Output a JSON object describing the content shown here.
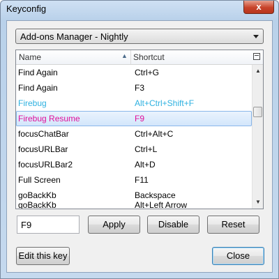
{
  "window": {
    "title": "Keyconfig",
    "close_glyph": "x"
  },
  "dropdown": {
    "selected": "Add-ons Manager - Nightly"
  },
  "list": {
    "columns": {
      "name": "Name",
      "shortcut": "Shortcut"
    },
    "rows": [
      {
        "name": "Find Again",
        "shortcut": "Ctrl+G",
        "color": "#000000"
      },
      {
        "name": "Find Again",
        "shortcut": "F3",
        "color": "#000000"
      },
      {
        "name": "Firebug",
        "shortcut": "Alt+Ctrl+Shift+F",
        "color": "#2eb1e0"
      },
      {
        "name": "Firebug Resume",
        "shortcut": "F9",
        "color": "#e0109c",
        "selected": true
      },
      {
        "name": "focusChatBar",
        "shortcut": "Ctrl+Alt+C",
        "color": "#000000"
      },
      {
        "name": "focusURLBar",
        "shortcut": "Ctrl+L",
        "color": "#000000"
      },
      {
        "name": "focusURLBar2",
        "shortcut": "Alt+D",
        "color": "#000000"
      },
      {
        "name": "Full Screen",
        "shortcut": "F11",
        "color": "#000000"
      },
      {
        "name": "goBackKb",
        "shortcut": "Backspace",
        "color": "#000000"
      },
      {
        "name": "goBackKb",
        "shortcut": "Alt+Left Arrow",
        "color": "#000000",
        "partial": true
      }
    ]
  },
  "editor": {
    "key_value": "F9",
    "apply_label": "Apply",
    "disable_label": "Disable",
    "reset_label": "Reset"
  },
  "footer": {
    "edit_label": "Edit this key",
    "close_label": "Close"
  }
}
